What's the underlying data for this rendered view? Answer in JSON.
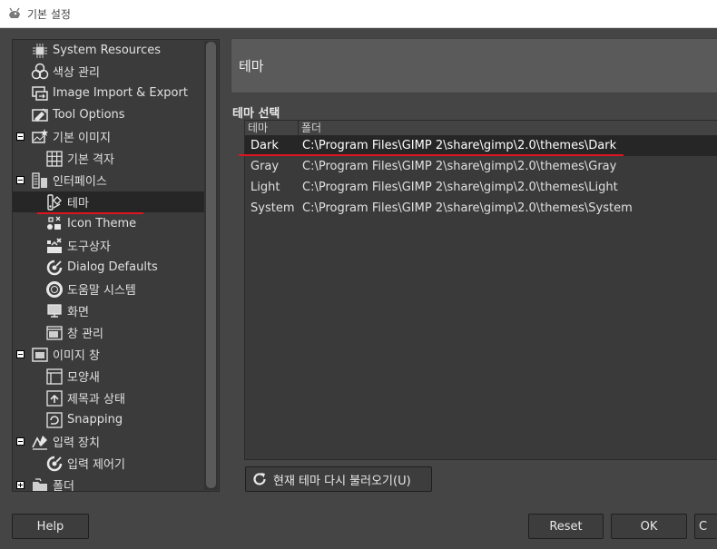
{
  "window": {
    "title": "기본 설정"
  },
  "tree": {
    "items": [
      {
        "label": "System Resources",
        "icon": "chip-icon",
        "expander": ""
      },
      {
        "label": "색상 관리",
        "icon": "color-management-icon",
        "expander": ""
      },
      {
        "label": "Image Import & Export",
        "icon": "image-import-export-icon",
        "expander": ""
      },
      {
        "label": "Tool Options",
        "icon": "tool-options-icon",
        "expander": ""
      },
      {
        "label": "기본 이미지",
        "icon": "default-image-icon",
        "expander": "minus"
      },
      {
        "label": "기본 격자",
        "icon": "grid-icon",
        "expander": ""
      },
      {
        "label": "인터페이스",
        "icon": "interface-icon",
        "expander": "minus"
      },
      {
        "label": "테마",
        "icon": "theme-icon",
        "expander": "",
        "selected": true
      },
      {
        "label": "Icon Theme",
        "icon": "icon-theme-icon",
        "expander": ""
      },
      {
        "label": "도구상자",
        "icon": "toolbox-icon",
        "expander": ""
      },
      {
        "label": "Dialog Defaults",
        "icon": "dialog-defaults-icon",
        "expander": ""
      },
      {
        "label": "도움말 시스템",
        "icon": "lifebuoy-icon",
        "expander": ""
      },
      {
        "label": "화면",
        "icon": "display-icon",
        "expander": ""
      },
      {
        "label": "창 관리",
        "icon": "window-management-icon",
        "expander": ""
      },
      {
        "label": "이미지 창",
        "icon": "image-window-icon",
        "expander": "minus"
      },
      {
        "label": "모양새",
        "icon": "appearance-icon",
        "expander": ""
      },
      {
        "label": "제목과 상태",
        "icon": "title-status-icon",
        "expander": ""
      },
      {
        "label": "Snapping",
        "icon": "snapping-icon",
        "expander": ""
      },
      {
        "label": "입력 장치",
        "icon": "input-devices-icon",
        "expander": "minus"
      },
      {
        "label": "입력 제어기",
        "icon": "input-controllers-icon",
        "expander": ""
      },
      {
        "label": "폴더",
        "icon": "folders-icon",
        "expander": "plus"
      }
    ]
  },
  "page": {
    "title": "테마",
    "section": "테마 선택",
    "columns": [
      "테마",
      "폴더"
    ],
    "rows": [
      {
        "name": "Dark",
        "folder": "C:\\Program Files\\GIMP 2\\share\\gimp\\2.0\\themes\\Dark",
        "selected": true
      },
      {
        "name": "Gray",
        "folder": "C:\\Program Files\\GIMP 2\\share\\gimp\\2.0\\themes\\Gray"
      },
      {
        "name": "Light",
        "folder": "C:\\Program Files\\GIMP 2\\share\\gimp\\2.0\\themes\\Light"
      },
      {
        "name": "System",
        "folder": "C:\\Program Files\\GIMP 2\\share\\gimp\\2.0\\themes\\System"
      }
    ],
    "reload_label": "현재 테마 다시 불러오기(U)"
  },
  "buttons": {
    "help": "Help",
    "reset": "Reset",
    "ok": "OK",
    "cancel": "C"
  },
  "colors": {
    "annotation": "#e0141e",
    "selection": "#262626"
  }
}
